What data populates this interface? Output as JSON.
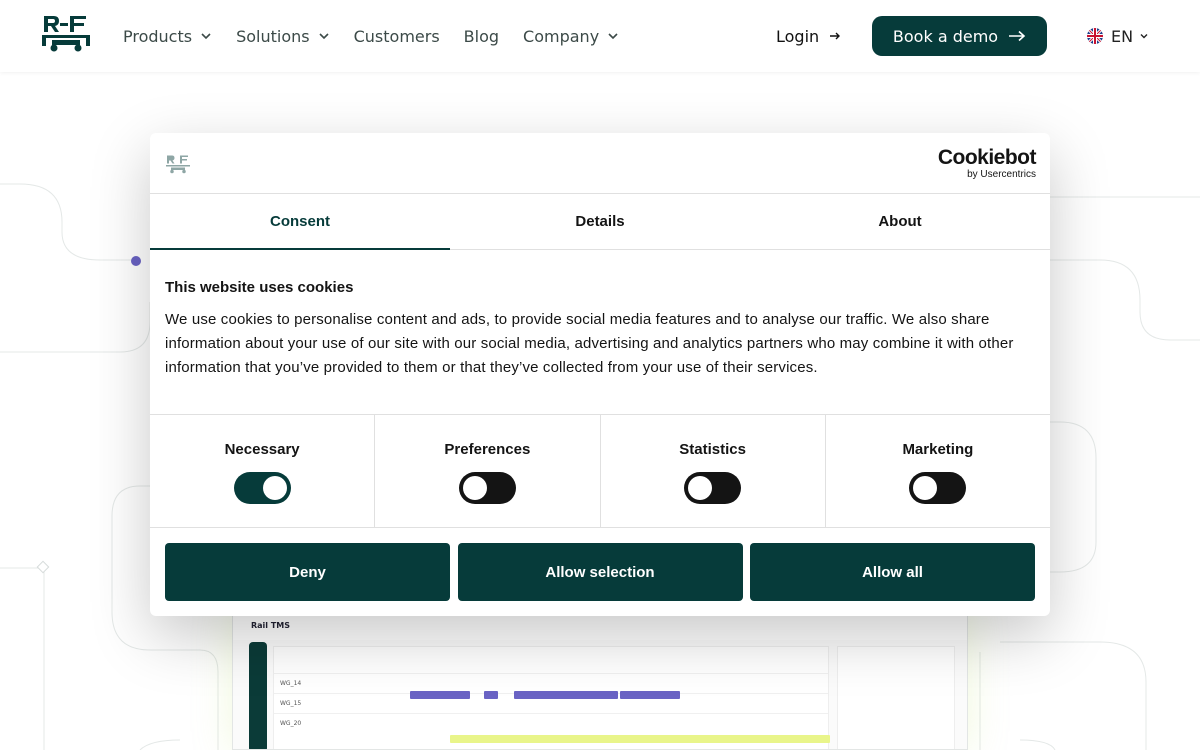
{
  "header": {
    "nav": [
      {
        "label": "Products",
        "has_menu": true
      },
      {
        "label": "Solutions",
        "has_menu": true
      },
      {
        "label": "Customers",
        "has_menu": false
      },
      {
        "label": "Blog",
        "has_menu": false
      },
      {
        "label": "Company",
        "has_menu": true
      }
    ],
    "login_label": "Login",
    "demo_label": "Book a demo",
    "language": "EN"
  },
  "preview": {
    "title": "Rail TMS",
    "rows": [
      "WG_14",
      "WG_15",
      "WG_20"
    ]
  },
  "dialog": {
    "brand_main": "Cookiebot",
    "brand_sub": "by Usercentrics",
    "tabs": [
      "Consent",
      "Details",
      "About"
    ],
    "title": "This website uses cookies",
    "text": "We use cookies to personalise content and ads, to provide social media features and to analyse our traffic. We also share information about your use of our site with our social media, advertising and analytics partners who may combine it with other information that you’ve provided to them or that they’ve collected from your use of their services.",
    "toggles": [
      {
        "label": "Necessary",
        "on": true
      },
      {
        "label": "Preferences",
        "on": false
      },
      {
        "label": "Statistics",
        "on": false
      },
      {
        "label": "Marketing",
        "on": false
      }
    ],
    "buttons": {
      "deny": "Deny",
      "allow_selection": "Allow selection",
      "allow_all": "Allow all"
    }
  },
  "colors": {
    "brand_dark": "#063b3a",
    "accent_purple": "#6a63c4"
  }
}
